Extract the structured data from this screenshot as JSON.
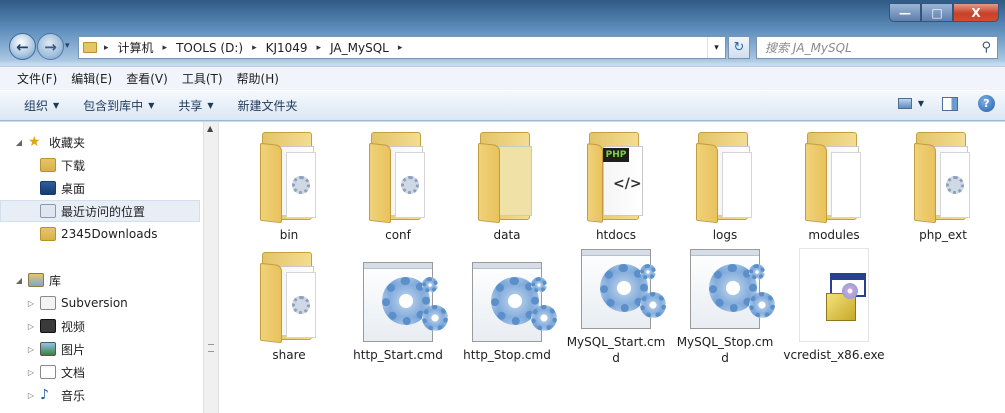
{
  "window": {
    "min": "—",
    "max": "□",
    "close": "X"
  },
  "nav": {
    "back": "←",
    "forward": "→",
    "dropdown": "▾"
  },
  "address": {
    "crumbs": [
      "计算机",
      "TOOLS (D:)",
      "KJ1049",
      "JA_MySQL"
    ],
    "separator": "▸",
    "dropdown": "▾",
    "refresh": "↻"
  },
  "search": {
    "placeholder": "搜索 JA_MySQL",
    "icon": "search-icon"
  },
  "menu": [
    "文件(F)",
    "编辑(E)",
    "查看(V)",
    "工具(T)",
    "帮助(H)"
  ],
  "toolbar": {
    "organize": "组织",
    "include": "包含到库中",
    "share": "共享",
    "newfolder": "新建文件夹",
    "arrow": "▼",
    "help": "?"
  },
  "sidebar": {
    "favorites": {
      "label": "收藏夹",
      "items": [
        "下载",
        "桌面",
        "最近访问的位置",
        "2345Downloads"
      ]
    },
    "libraries": {
      "label": "库",
      "items": [
        "Subversion",
        "视频",
        "图片",
        "文档",
        "音乐"
      ]
    },
    "selected": "最近访问的位置"
  },
  "files": [
    {
      "name": "bin",
      "type": "folder"
    },
    {
      "name": "conf",
      "type": "folder"
    },
    {
      "name": "data",
      "type": "folder"
    },
    {
      "name": "htdocs",
      "type": "folder-php"
    },
    {
      "name": "logs",
      "type": "folder"
    },
    {
      "name": "modules",
      "type": "folder"
    },
    {
      "name": "php_ext",
      "type": "folder"
    },
    {
      "name": "share",
      "type": "folder"
    },
    {
      "name": "http_Start.cmd",
      "type": "cmd"
    },
    {
      "name": "http_Stop.cmd",
      "type": "cmd"
    },
    {
      "name": "MySQL_Start.cmd",
      "type": "cmd"
    },
    {
      "name": "MySQL_Stop.cmd",
      "type": "cmd"
    },
    {
      "name": "vcredist_x86.exe",
      "type": "exe"
    }
  ],
  "php_badge": "PHP",
  "colors": {
    "folder": "#e6c567",
    "accent": "#5b8fc9",
    "selection": "#e8eef6"
  }
}
